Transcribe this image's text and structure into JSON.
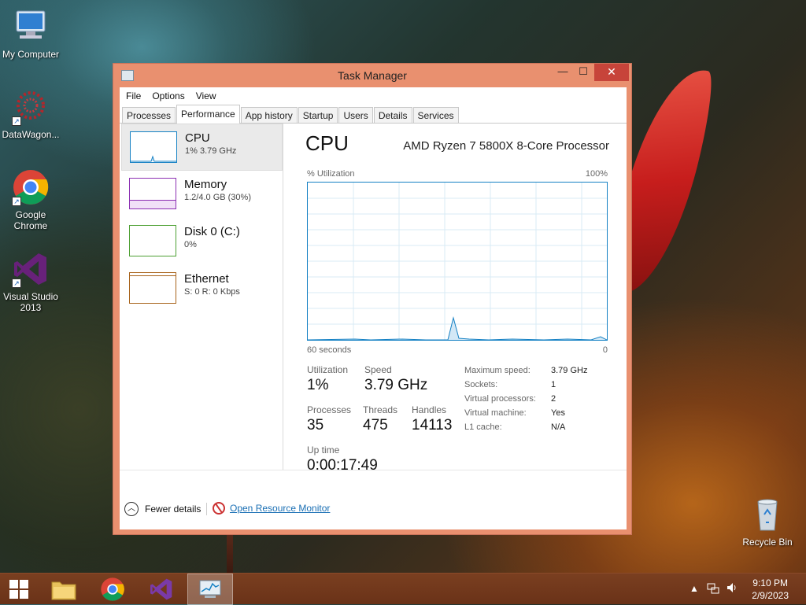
{
  "desktop": {
    "icons": [
      {
        "label": "My Computer"
      },
      {
        "label": "DataWagon..."
      },
      {
        "label": "Google Chrome"
      },
      {
        "label": "Visual Studio 2013"
      },
      {
        "label": "Recycle Bin"
      }
    ]
  },
  "window": {
    "title": "Task Manager",
    "buttons": {
      "min": "—",
      "max": "☐",
      "close": "✕"
    }
  },
  "menu": [
    "File",
    "Options",
    "View"
  ],
  "tabs": [
    "Processes",
    "Performance",
    "App history",
    "Startup",
    "Users",
    "Details",
    "Services"
  ],
  "active_tab": "Performance",
  "resources": [
    {
      "name": "CPU",
      "value": "1%  3.79 GHz",
      "color": "#1581c4"
    },
    {
      "name": "Memory",
      "value": "1.2/4.0 GB (30%)",
      "color": "#8b2fb2"
    },
    {
      "name": "Disk 0 (C:)",
      "value": "0%",
      "color": "#4da033"
    },
    {
      "name": "Ethernet",
      "value": "S: 0 R: 0 Kbps",
      "color": "#a7621a"
    }
  ],
  "detail": {
    "title": "CPU",
    "processor": "AMD Ryzen 7 5800X 8-Core Processor",
    "graph_top_left": "% Utilization",
    "graph_top_right": "100%",
    "graph_bottom_left": "60 seconds",
    "graph_bottom_right": "0",
    "stats": {
      "utilization_label": "Utilization",
      "utilization": "1%",
      "speed_label": "Speed",
      "speed": "3.79 GHz",
      "processes_label": "Processes",
      "processes": "35",
      "threads_label": "Threads",
      "threads": "475",
      "handles_label": "Handles",
      "handles": "14113",
      "uptime_label": "Up time",
      "uptime": "0:00:17:49"
    },
    "specs": [
      {
        "label": "Maximum speed:",
        "value": "3.79 GHz"
      },
      {
        "label": "Sockets:",
        "value": "1"
      },
      {
        "label": "Virtual processors:",
        "value": "2"
      },
      {
        "label": "Virtual machine:",
        "value": "Yes"
      },
      {
        "label": "L1 cache:",
        "value": "N/A"
      }
    ]
  },
  "footer": {
    "fewer_details": "Fewer details",
    "resource_monitor": "Open Resource Monitor"
  },
  "taskbar": {
    "items": [
      "start-button",
      "file-explorer",
      "chrome",
      "visual-studio",
      "task-manager"
    ],
    "time": "9:10 PM",
    "date": "2/9/2023"
  }
}
